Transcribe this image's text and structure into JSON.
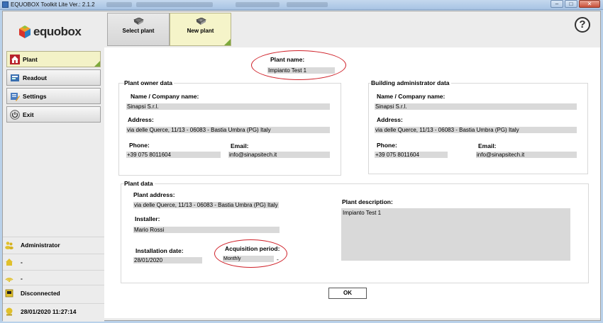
{
  "window": {
    "title": "EQUOBOX Toolkit Lite Ver.: 2.1.2",
    "controls": {
      "minimize": "–",
      "maximize": "□",
      "close": "✕"
    }
  },
  "logo": {
    "word": "equobox"
  },
  "toolbar": {
    "select_plant": "Select plant",
    "new_plant": "New plant",
    "help": "?"
  },
  "sidebar": {
    "items": [
      {
        "label": "Plant",
        "icon": "house-icon"
      },
      {
        "label": "Readout",
        "icon": "readout-icon"
      },
      {
        "label": "Settings",
        "icon": "settings-icon"
      },
      {
        "label": "Exit",
        "icon": "power-icon"
      }
    ],
    "status": {
      "user": "Administrator",
      "line2": "-",
      "line3": "-",
      "connection": "Disconnected",
      "datetime": "28/01/2020 11:27:14"
    }
  },
  "plant": {
    "name_label": "Plant name:",
    "name": "Impianto Test 1"
  },
  "owner": {
    "title": "Plant owner data",
    "name_label": "Name / Company name:",
    "name": "Sinapsi S.r.l.",
    "address_label": "Address:",
    "address": "via delle Querce, 11/13 - 06083 - Bastia Umbra (PG) Italy",
    "phone_label": "Phone:",
    "phone": "+39 075 8011604",
    "email_label": "Email:",
    "email": "info@sinapsitech.it"
  },
  "admin": {
    "title": "Building administrator data",
    "name_label": "Name / Company name:",
    "name": "Sinapsi S.r.l.",
    "address_label": "Address:",
    "address": "via delle Querce, 11/13 - 06083 - Bastia Umbra (PG) Italy",
    "phone_label": "Phone:",
    "phone": "+39 075 8011604",
    "email_label": "Email:",
    "email": "info@sinapsitech.it"
  },
  "plant_data": {
    "title": "Plant data",
    "address_label": "Plant address:",
    "address": "via delle Querce, 11/13 - 06083 - Bastia Umbra (PG) Italy",
    "installer_label": "Installer:",
    "installer": "Mario Rossi",
    "install_date_label": "Installation date:",
    "install_date": "28/01/2020",
    "acq_label": "Acquisition period:",
    "acq_value": "Monthly",
    "acq_suffix": "-",
    "description_label": "Plant description:",
    "description": "Impianto Test 1"
  },
  "actions": {
    "ok": "OK"
  },
  "colors": {
    "highlight_ellipse": "#cf1f27",
    "active_item": "#f3f2c7",
    "accent_corner": "#7da93b"
  }
}
